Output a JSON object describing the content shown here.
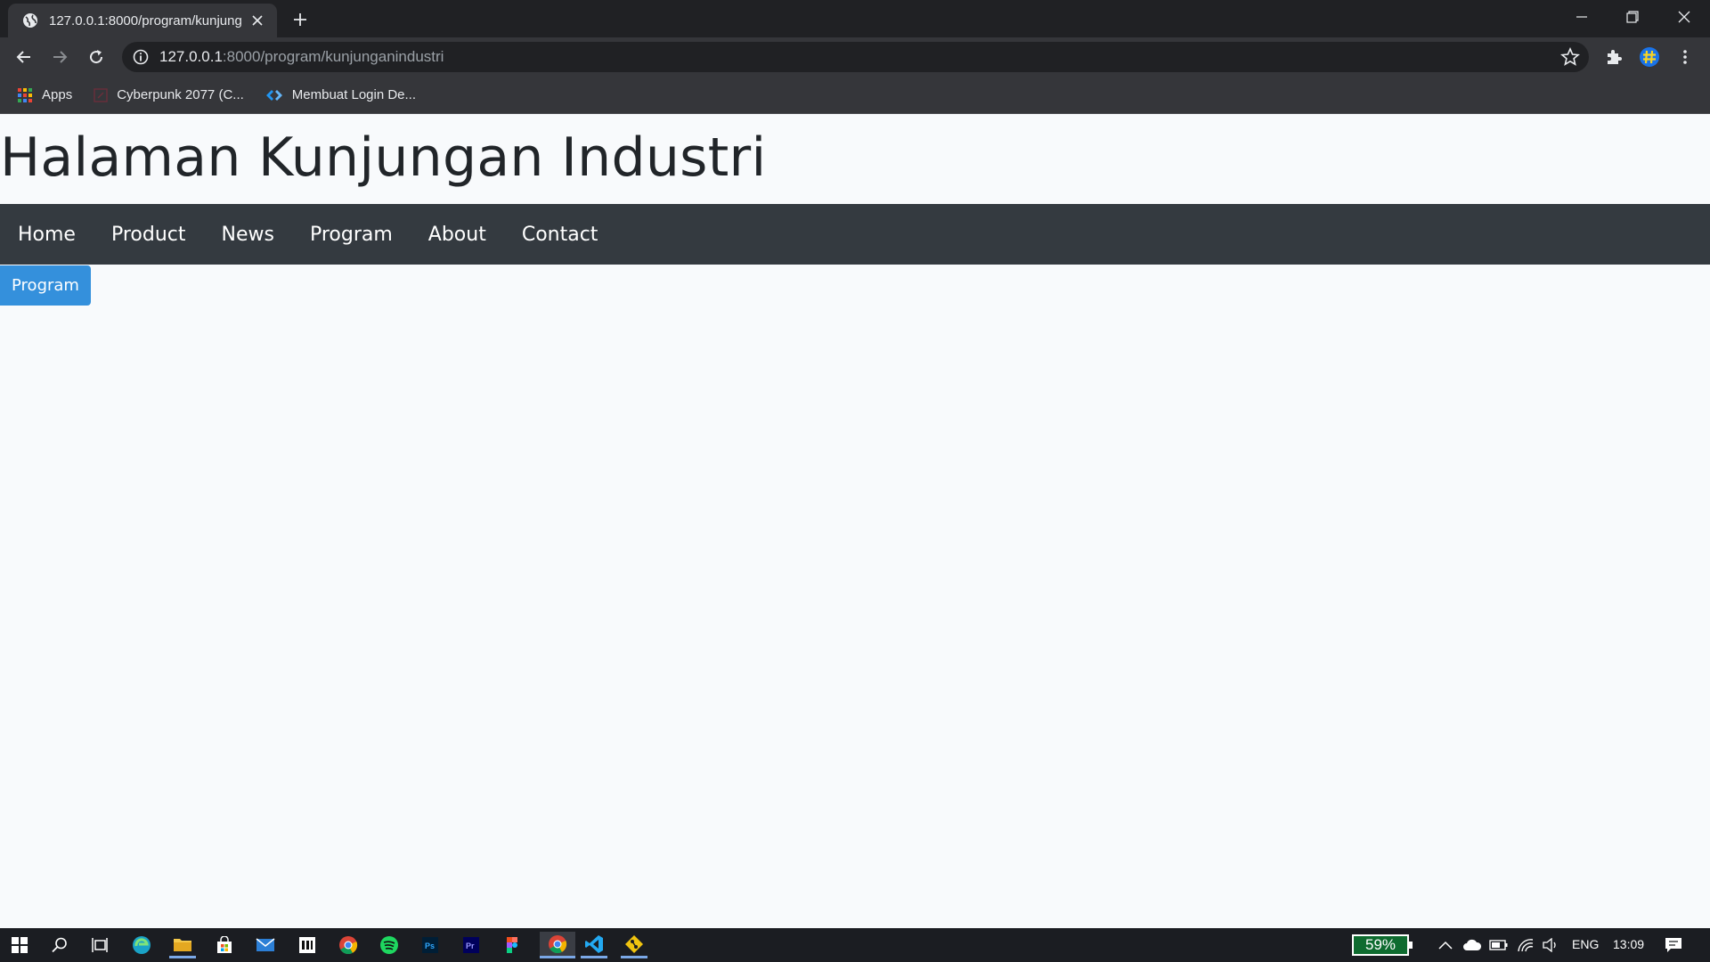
{
  "browser": {
    "tab_title": "127.0.0.1:8000/program/kunjung",
    "url_host": "127.0.0.1",
    "url_rest": ":8000/program/kunjunganindustri",
    "bookmarks": [
      {
        "label": "Apps",
        "icon": "apps-grid-icon"
      },
      {
        "label": "Cyberpunk 2077 (C...",
        "icon": "cyberpunk-favicon"
      },
      {
        "label": "Membuat Login De...",
        "icon": "code-favicon"
      }
    ]
  },
  "page": {
    "title": "Halaman Kunjungan Industri",
    "nav": [
      "Home",
      "Product",
      "News",
      "Program",
      "About",
      "Contact"
    ],
    "button_label": "Program"
  },
  "taskbar": {
    "battery_widget": "59%",
    "language": "ENG",
    "time": "13:09"
  },
  "colors": {
    "navbar": "#343a40",
    "button": "#3490dc",
    "page_bg": "#f8fafc",
    "browser_dark": "#202124",
    "browser_toolbar": "#35363a",
    "taskbar": "#1b1d22"
  }
}
